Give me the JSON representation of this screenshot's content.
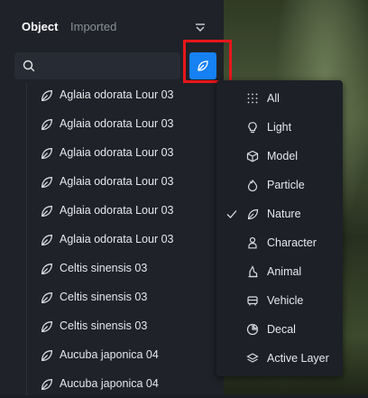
{
  "tabs": {
    "object_label": "Object",
    "imported_label": "Imported"
  },
  "search": {
    "value": "",
    "placeholder": ""
  },
  "colors": {
    "accent": "#1681f2",
    "highlight": "#e8161b",
    "panel": "#1f2228",
    "menu": "#1d2026"
  },
  "filter_button": {
    "icon": "leaf-icon",
    "highlighted": true
  },
  "assets": [
    {
      "name": "Aglaia odorata Lour 03",
      "icon": "leaf-icon"
    },
    {
      "name": "Aglaia odorata Lour 03",
      "icon": "leaf-icon"
    },
    {
      "name": "Aglaia odorata Lour 03",
      "icon": "leaf-icon"
    },
    {
      "name": "Aglaia odorata Lour 03",
      "icon": "leaf-icon"
    },
    {
      "name": "Aglaia odorata Lour 03",
      "icon": "leaf-icon"
    },
    {
      "name": "Aglaia odorata Lour 03",
      "icon": "leaf-icon"
    },
    {
      "name": "Celtis sinensis 03",
      "icon": "leaf-icon"
    },
    {
      "name": "Celtis sinensis 03",
      "icon": "leaf-icon"
    },
    {
      "name": "Celtis sinensis 03",
      "icon": "leaf-icon"
    },
    {
      "name": "Aucuba japonica 04",
      "icon": "leaf-icon"
    },
    {
      "name": "Aucuba japonica 04",
      "icon": "leaf-icon"
    }
  ],
  "filter_menu": {
    "items": [
      {
        "label": "All",
        "icon": "grid-dots-icon",
        "checked": false
      },
      {
        "label": "Light",
        "icon": "lightbulb-icon",
        "checked": false
      },
      {
        "label": "Model",
        "icon": "cube-icon",
        "checked": false
      },
      {
        "label": "Particle",
        "icon": "flame-icon",
        "checked": false
      },
      {
        "label": "Nature",
        "icon": "leaf-icon",
        "checked": true
      },
      {
        "label": "Character",
        "icon": "person-icon",
        "checked": false
      },
      {
        "label": "Animal",
        "icon": "animal-icon",
        "checked": false
      },
      {
        "label": "Vehicle",
        "icon": "vehicle-icon",
        "checked": false
      },
      {
        "label": "Decal",
        "icon": "decal-icon",
        "checked": false
      },
      {
        "label": "Active Layer",
        "icon": "layers-icon",
        "checked": false
      }
    ]
  }
}
